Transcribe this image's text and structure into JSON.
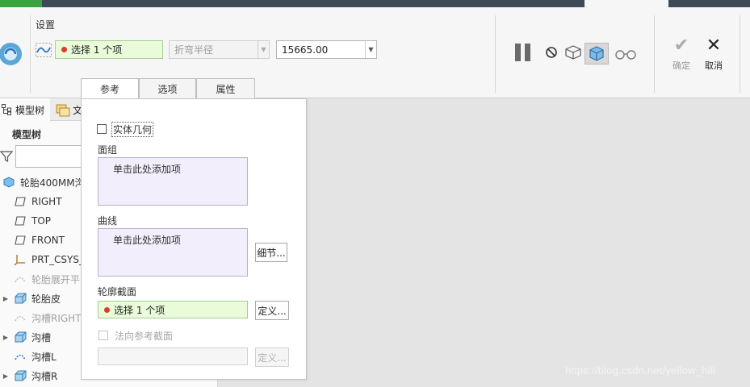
{
  "dashboard": {
    "settings_title": "设置",
    "collector_label": "选择 1 个项",
    "bend_radius": {
      "placeholder": "折弯半径"
    },
    "value_field": {
      "value": "15665.00"
    },
    "ok_label": "确定",
    "cancel_label": "取消"
  },
  "popup_tabs": [
    "参考",
    "选项",
    "属性"
  ],
  "tree": {
    "tab_model": "模型树",
    "tab_file": "文",
    "title": "模型树",
    "items": [
      {
        "label": "轮胎400MM沟",
        "icon": "part-icon",
        "expandable": false,
        "dim": false
      },
      {
        "label": "RIGHT",
        "icon": "datum-plane-icon",
        "expandable": false,
        "dim": false
      },
      {
        "label": "TOP",
        "icon": "datum-plane-icon",
        "expandable": false,
        "dim": false
      },
      {
        "label": "FRONT",
        "icon": "datum-plane-icon",
        "expandable": false,
        "dim": false
      },
      {
        "label": "PRT_CSYS_",
        "icon": "csys-icon",
        "expandable": false,
        "dim": false
      },
      {
        "label": "轮胎展开平",
        "icon": "flatten-icon",
        "expandable": false,
        "dim": true
      },
      {
        "label": "轮胎皮",
        "icon": "solid-feature-icon",
        "expandable": true,
        "dim": false
      },
      {
        "label": "沟槽RIGHT",
        "icon": "flatten-icon",
        "expandable": false,
        "dim": true
      },
      {
        "label": "沟槽",
        "icon": "solid-feature-icon",
        "expandable": true,
        "dim": false
      },
      {
        "label": "沟槽L",
        "icon": "bend-icon",
        "expandable": false,
        "dim": false
      },
      {
        "label": "沟槽R",
        "icon": "solid-feature-icon",
        "expandable": true,
        "dim": false
      }
    ]
  },
  "panel": {
    "solid_geometry": "实体几何",
    "quilts_label": "面组",
    "quilts_placeholder": "单击此处添加项",
    "curves_label": "曲线",
    "curves_placeholder": "单击此处添加项",
    "details_button": "细节...",
    "profile_label": "轮廓截面",
    "profile_collector": "选择 1 个项",
    "define_button": "定义...",
    "normal_ref_label": "法向参考截面",
    "define_button_2": "定义..."
  },
  "watermark": "https://blog.csdn.net/yellow_hill"
}
